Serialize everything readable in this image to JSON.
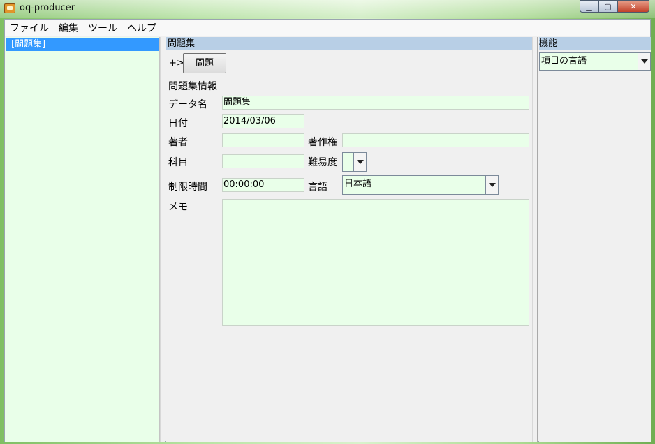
{
  "window": {
    "title": "oq-producer",
    "minimize_glyph": "▁",
    "maximize_glyph": "▢",
    "close_glyph": "✕"
  },
  "menubar": {
    "items": [
      "ファイル",
      "編集",
      "ツール",
      "ヘルプ"
    ]
  },
  "tree": {
    "selected_item": "[問題集]"
  },
  "center": {
    "header": "問題集",
    "add_prefix": "+>",
    "add_button_label": "問題",
    "section_title": "問題集情報",
    "fields": {
      "data_name": {
        "label": "データ名",
        "value": "問題集"
      },
      "date": {
        "label": "日付",
        "value": "2014/03/06"
      },
      "author": {
        "label": "著者",
        "value": ""
      },
      "copyright": {
        "label": "著作権",
        "value": ""
      },
      "subject": {
        "label": "科目",
        "value": ""
      },
      "difficulty": {
        "label": "難易度",
        "value": ""
      },
      "time_limit": {
        "label": "制限時間",
        "value": "00:00:00"
      },
      "language": {
        "label": "言語",
        "value": "日本語"
      },
      "memo": {
        "label": "メモ",
        "value": ""
      }
    }
  },
  "right": {
    "header": "機能",
    "function_select": "項目の言語"
  },
  "colors": {
    "field_bg": "#e9ffe9",
    "header_bg": "#b8cfe6",
    "selection": "#3399ff"
  }
}
